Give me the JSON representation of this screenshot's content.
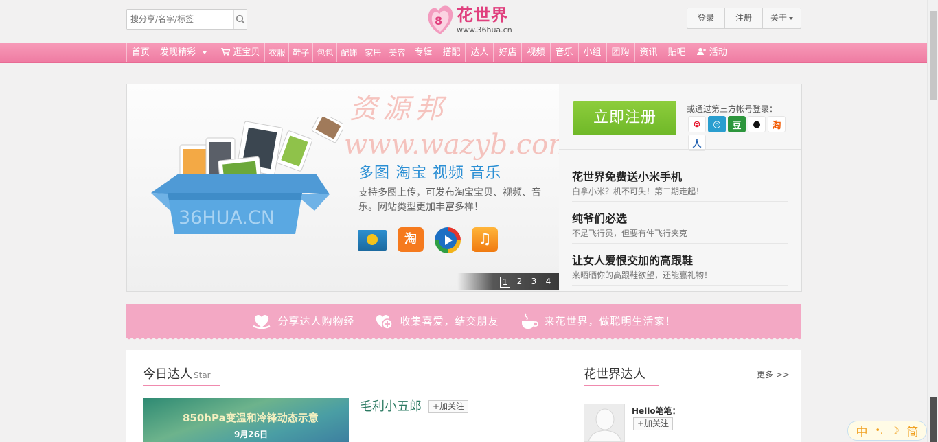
{
  "header": {
    "search_placeholder": "搜分享/名字/标签",
    "logo_title": "花世界",
    "logo_url": "www.36hua.cn",
    "login_label": "登录",
    "register_label": "注册",
    "about_label": "关于"
  },
  "nav": {
    "items": [
      "首页",
      "发现精彩",
      "逛宝贝",
      "衣服",
      "鞋子",
      "包包",
      "配饰",
      "家居",
      "美容",
      "专辑",
      "搭配",
      "达人",
      "好店",
      "视频",
      "音乐",
      "小组",
      "团购",
      "资讯",
      "贴吧",
      "活动"
    ]
  },
  "banner": {
    "slide_title": "多图 淘宝 视频 音乐",
    "slide_desc": "支持多图上传，可发布淘宝宝贝、视频、音乐。网站类型更加丰富多样！",
    "box_text": "36HUA.CN",
    "watermark_line1": "资源邦",
    "watermark_line2": "www.wazyb.com",
    "pager": [
      "1",
      "2",
      "3",
      "4"
    ],
    "active_page": "1"
  },
  "side": {
    "register_button": "立即注册",
    "third_party_label": "或通过第三方帐号登录：",
    "third_party_icons": [
      "weibo-icon",
      "tencent-weibo-icon",
      "douban-icon",
      "qq-icon",
      "taobao-icon",
      "renren-icon"
    ],
    "news": [
      {
        "title": "花世界免费送小米手机",
        "desc": "白拿小米？机不可失！第二期走起！"
      },
      {
        "title": "纯爷们必选",
        "desc": "不是飞行员，但要有件飞行夹克"
      },
      {
        "title": "让女人爱恨交加的高跟鞋",
        "desc": "来晒晒你的高跟鞋欲望，还能赢礼物！"
      }
    ]
  },
  "slogan": {
    "items": [
      "分享达人购物经",
      "收集喜爱，结交朋友",
      "来花世界，做聪明生活家！"
    ]
  },
  "today_star": {
    "title": "今日达人",
    "subtitle": "Star",
    "image_text_1": "850hPa变温和冷锋动态示意",
    "image_text_2": "9月26日",
    "user_name": "毛利小五郎",
    "follow_label": "+加关注"
  },
  "world_stars": {
    "title": "花世界达人",
    "more_label": "更多 >>",
    "user_name": "Hello笔笔：",
    "follow_label": "+加关注"
  },
  "ime": {
    "label_left": "中",
    "label_right": "简"
  },
  "colors": {
    "brand_pink": "#ef7ba2",
    "register_green": "#7cc232",
    "link_green": "#2d7b63"
  }
}
